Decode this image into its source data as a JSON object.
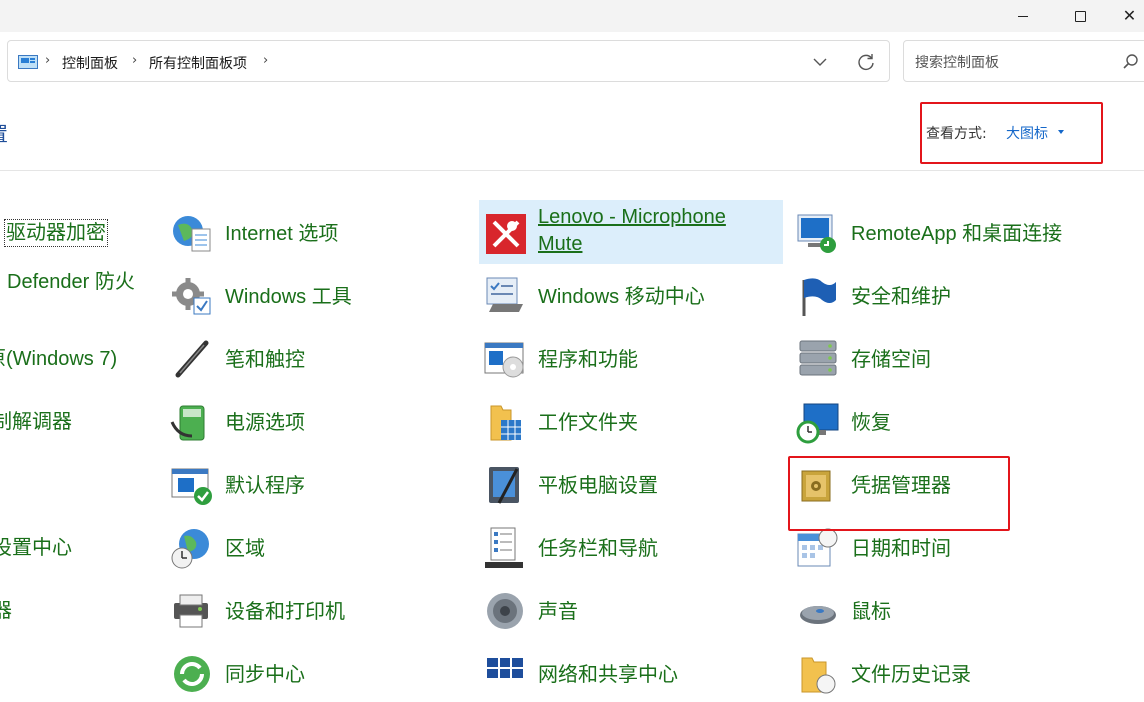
{
  "window": {
    "minimize": "—",
    "maximize": "□",
    "close": "✕"
  },
  "address": {
    "breadcrumbs": [
      "控制面板",
      "所有控制面板项"
    ],
    "icons": {
      "root": "control-panel-icon",
      "dropdown": "chevron-down-icon",
      "refresh": "refresh-icon"
    }
  },
  "search": {
    "placeholder": "搜索控制面板",
    "value": ""
  },
  "header": {
    "title": "置",
    "view_label": "查看方式:",
    "view_value": "大图标"
  },
  "columns": [
    {
      "items": [
        {
          "label": "驱动器加密",
          "icon": "bitlocker-icon"
        },
        {
          "label": "Defender 防火",
          "icon": "firewall-icon"
        },
        {
          "label": "原(Windows 7)",
          "icon": "backup-restore-icon"
        },
        {
          "label": "制解调器",
          "icon": "modem-icon"
        },
        {
          "label": "",
          "icon": ""
        },
        {
          "label": "设置中心",
          "icon": "ease-of-access-icon"
        },
        {
          "label": "器",
          "icon": "device-manager-icon"
        }
      ]
    },
    {
      "items": [
        {
          "label": "Internet 选项",
          "icon": "internet-options-icon"
        },
        {
          "label": "Windows 工具",
          "icon": "windows-tools-icon"
        },
        {
          "label": "笔和触控",
          "icon": "pen-touch-icon"
        },
        {
          "label": "电源选项",
          "icon": "power-options-icon"
        },
        {
          "label": "默认程序",
          "icon": "default-programs-icon"
        },
        {
          "label": "区域",
          "icon": "region-icon"
        },
        {
          "label": "设备和打印机",
          "icon": "devices-printers-icon"
        },
        {
          "label": "同步中心",
          "icon": "sync-center-icon"
        }
      ]
    },
    {
      "items": [
        {
          "label": "Lenovo - Microphone Mute",
          "icon": "microphone-mute-icon"
        },
        {
          "label": "Windows 移动中心",
          "icon": "mobility-center-icon"
        },
        {
          "label": "程序和功能",
          "icon": "programs-features-icon"
        },
        {
          "label": "工作文件夹",
          "icon": "work-folders-icon"
        },
        {
          "label": "平板电脑设置",
          "icon": "tablet-settings-icon"
        },
        {
          "label": "任务栏和导航",
          "icon": "taskbar-icon"
        },
        {
          "label": "声音",
          "icon": "sound-icon"
        },
        {
          "label": "网络和共享中心",
          "icon": "network-sharing-icon"
        }
      ]
    },
    {
      "items": [
        {
          "label": "RemoteApp 和桌面连接",
          "icon": "remoteapp-icon"
        },
        {
          "label": "安全和维护",
          "icon": "security-maintenance-icon"
        },
        {
          "label": "存储空间",
          "icon": "storage-spaces-icon"
        },
        {
          "label": "恢复",
          "icon": "recovery-icon"
        },
        {
          "label": "凭据管理器",
          "icon": "credential-manager-icon"
        },
        {
          "label": "日期和时间",
          "icon": "date-time-icon"
        },
        {
          "label": "鼠标",
          "icon": "mouse-icon"
        },
        {
          "label": "文件历史记录",
          "icon": "file-history-icon"
        }
      ]
    }
  ],
  "colors": {
    "link_green": "#1a6f1a",
    "accent_blue": "#1467c9",
    "annotation_red": "#e3151b",
    "hover_bg": "#dceefb"
  }
}
